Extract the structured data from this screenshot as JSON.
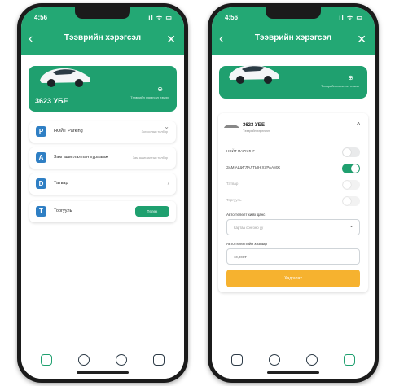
{
  "left_phone": {
    "status": {
      "time": "4:56",
      "system": "ıl ᯤ ▭"
    },
    "header": {
      "back": "‹",
      "title": "Тээврийн хэрэгсэл",
      "close": "✕"
    },
    "car_card": {
      "plate": "3623 УБЕ",
      "mini_label": "Тээврийн хэрэгсэл нэмэх"
    },
    "menu": [
      {
        "icon": "P",
        "label": "НОЙТ Parking",
        "meta": "Зогсоолын төлбөр",
        "trailing": "⌄"
      },
      {
        "icon": "A",
        "label": "Зам ашиглалтын хураамж",
        "meta": "Зам ашиглалтын төлбөр",
        "trailing": ""
      },
      {
        "icon": "D",
        "label": "Татвар",
        "meta": "",
        "trailing": "›"
      },
      {
        "icon": "T",
        "label": "Торгууль",
        "meta": "",
        "trailing": "",
        "button": "Төлөх"
      }
    ]
  },
  "right_phone": {
    "status": {
      "time": "4:56",
      "system": "ıl ᯤ ▭"
    },
    "header": {
      "back": "‹",
      "title": "Тээврийн хэрэгсэл",
      "close": "✕"
    },
    "car_card": {
      "mini_label": "Тээврийн хэрэгсэл нэмэх"
    },
    "panel": {
      "vehicle": "3623 УБЕ",
      "vehicle_sub": "Тээврийн хэрэгсэл",
      "caret": "^",
      "toggles": [
        {
          "label": "НОЙТ ПАРКИНГ",
          "state": "off"
        },
        {
          "label": "ЗАМ АШИГЛАЛТЫН ХУРААМЖ",
          "state": "on"
        },
        {
          "label": "Татвар",
          "state": "dim"
        },
        {
          "label": "Торгууль",
          "state": "dim"
        }
      ],
      "select_label": "Авто төлөлт хийх данс",
      "select_placeholder": "Картаа сонгоно уу",
      "input_label": "Авто төлөлтийн хязгаар",
      "input_value": "10,000₮",
      "submit": "Хадгалах"
    }
  },
  "tabs": [
    {
      "name": "home",
      "active": true
    },
    {
      "name": "location",
      "active": false
    },
    {
      "name": "history",
      "active": false
    },
    {
      "name": "settings",
      "active": false
    }
  ],
  "colors": {
    "brand_green": "#1fa06f",
    "cta_orange": "#f6b22f",
    "icon_blue": "#2f7fc4"
  }
}
